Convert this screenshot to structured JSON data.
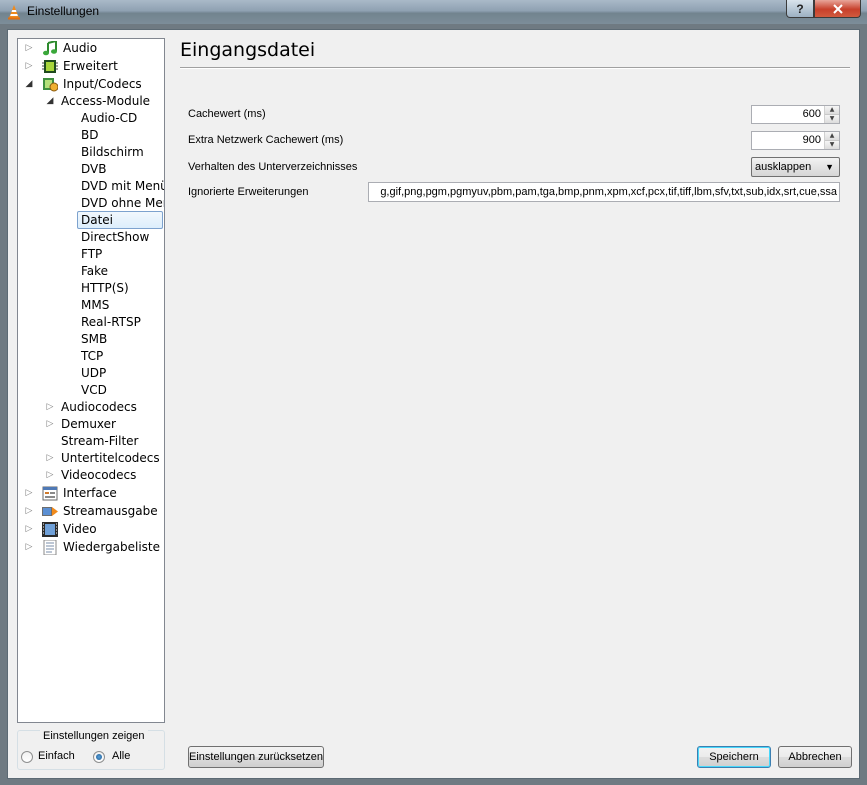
{
  "window": {
    "title": "Einstellungen",
    "help_label": "?",
    "close_label": "x"
  },
  "tree": {
    "items": [
      {
        "label": "Audio",
        "icon": "music-note-icon",
        "expanded": false
      },
      {
        "label": "Erweitert",
        "icon": "chip-icon",
        "expanded": false
      },
      {
        "label": "Input/Codecs",
        "icon": "codec-icon",
        "expanded": true
      },
      {
        "label": "Access-Module",
        "expanded": true
      },
      {
        "label": "Audio-CD"
      },
      {
        "label": "BD"
      },
      {
        "label": "Bildschirm"
      },
      {
        "label": "DVB"
      },
      {
        "label": "DVD mit Menüs"
      },
      {
        "label": "DVD ohne Menüs"
      },
      {
        "label": "Datei",
        "selected": true
      },
      {
        "label": "DirectShow"
      },
      {
        "label": "FTP"
      },
      {
        "label": "Fake"
      },
      {
        "label": "HTTP(S)"
      },
      {
        "label": "MMS"
      },
      {
        "label": "Real-RTSP"
      },
      {
        "label": "SMB"
      },
      {
        "label": "TCP"
      },
      {
        "label": "UDP"
      },
      {
        "label": "VCD"
      },
      {
        "label": "Audiocodecs",
        "expanded": false
      },
      {
        "label": "Demuxer",
        "expanded": false
      },
      {
        "label": "Stream-Filter"
      },
      {
        "label": "Untertitelcodecs",
        "expanded": false
      },
      {
        "label": "Videocodecs",
        "expanded": false
      },
      {
        "label": "Interface",
        "icon": "interface-icon",
        "expanded": false
      },
      {
        "label": "Streamausgabe",
        "icon": "stream-output-icon",
        "expanded": false
      },
      {
        "label": "Video",
        "icon": "film-icon",
        "expanded": false
      },
      {
        "label": "Wiedergabeliste",
        "icon": "playlist-icon",
        "expanded": false
      }
    ]
  },
  "show_settings": {
    "title": "Einstellungen zeigen",
    "simple_label": "Einfach",
    "all_label": "Alle",
    "selected": "Alle"
  },
  "main": {
    "title": "Eingangsdatei",
    "cache_label": "Cachewert (ms)",
    "cache_value": "600",
    "net_cache_label": "Extra Netzwerk Cachewert (ms)",
    "net_cache_value": "900",
    "subdir_label": "Verhalten des Unterverzeichnisses",
    "subdir_value": "ausklappen",
    "ignored_label": "Ignorierte Erweiterungen",
    "ignored_value": "g,gif,png,pgm,pgmyuv,pbm,pam,tga,bmp,pnm,xpm,xcf,pcx,tif,tiff,lbm,sfv,txt,sub,idx,srt,cue,ssa"
  },
  "buttons": {
    "reset": "Einstellungen zurücksetzen",
    "save": "Speichern",
    "cancel": "Abbrechen"
  }
}
